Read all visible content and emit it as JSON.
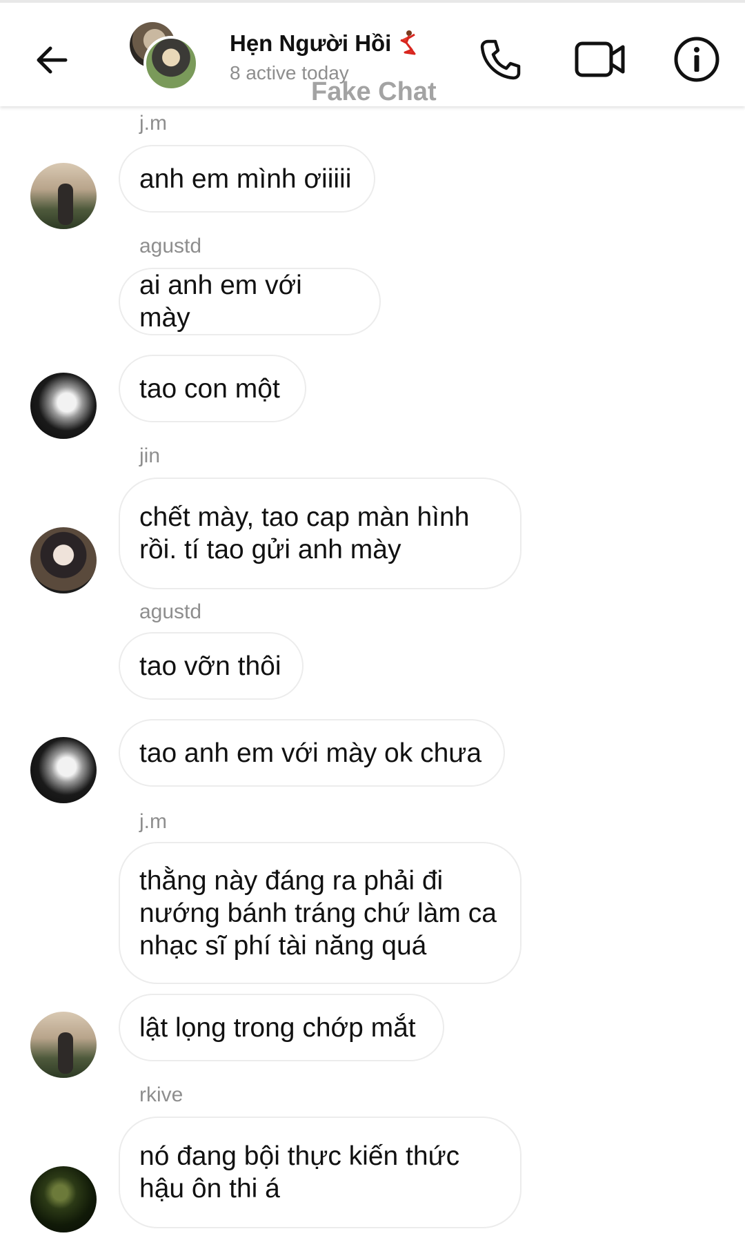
{
  "header": {
    "title": "Hẹn Người Hồi",
    "title_emoji": "dancer-emoji",
    "subtitle": "8 active today",
    "watermark": "Fake Chat",
    "icons": {
      "back": "arrow-left-icon",
      "call": "phone-icon",
      "video": "video-camera-icon",
      "info": "info-icon"
    }
  },
  "messages": [
    {
      "sender": "j.m",
      "text": "anh em mình ơiiiii",
      "avatar": "sunset-portrait"
    },
    {
      "sender": "agustd",
      "text": "ai anh em với mày",
      "avatar": null
    },
    {
      "sender": "",
      "text": "tao con một",
      "avatar": "dark-silhouette"
    },
    {
      "sender": "jin",
      "text": "chết mày, tao cap màn hình rồi. tí tao gửi anh mày",
      "avatar": "portrait"
    },
    {
      "sender": "agustd",
      "text": "tao vỡn thôi",
      "avatar": null
    },
    {
      "sender": "",
      "text": "tao anh em với mày ok chưa",
      "avatar": "dark-silhouette"
    },
    {
      "sender": "j.m",
      "text": "thằng này đáng ra phải đi nướng bánh tráng chứ làm ca nhạc sĩ phí tài năng quá",
      "avatar": null
    },
    {
      "sender": "",
      "text": "lật lọng trong chớp mắt",
      "avatar": "sunset-portrait"
    },
    {
      "sender": "rkive",
      "text": "nó đang bội thực kiến thức hậu ôn thi á",
      "avatar": "night-portrait"
    }
  ],
  "colors": {
    "bubble_border": "#ececec",
    "sender_text": "#8e8e8e",
    "message_text": "#111111"
  }
}
